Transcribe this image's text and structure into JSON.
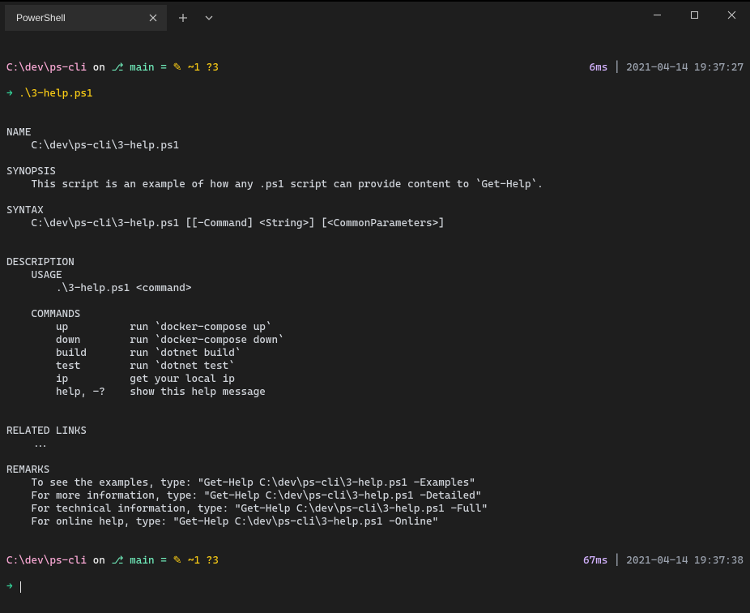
{
  "tab": {
    "label": "PowerShell"
  },
  "prompt1": {
    "path": "C:\\dev\\ps-cli",
    "on": " on ",
    "branch": "main",
    "eq": " =",
    "dirty": "~1 ?3",
    "elapsed": "6ms",
    "pipe": " │ ",
    "timestamp": "2021-04-14 19:37:27",
    "arrow": "→",
    "command": ".\\3-help.ps1"
  },
  "output": "\nNAME\n    C:\\dev\\ps-cli\\3-help.ps1\n\nSYNOPSIS\n    This script is an example of how any .ps1 script can provide content to `Get-Help`.\n\nSYNTAX\n    C:\\dev\\ps-cli\\3-help.ps1 [[-Command] <String>] [<CommonParameters>]\n\n\nDESCRIPTION\n    USAGE\n        .\\3-help.ps1 <command>\n\n    COMMANDS\n        up          run `docker-compose up`\n        down        run `docker-compose down`\n        build       run `dotnet build`\n        test        run `dotnet test`\n        ip          get your local ip\n        help, -?    show this help message\n\n\nRELATED LINKS\n    ...\n\nREMARKS\n    To see the examples, type: \"Get-Help C:\\dev\\ps-cli\\3-help.ps1 -Examples\"\n    For more information, type: \"Get-Help C:\\dev\\ps-cli\\3-help.ps1 -Detailed\"\n    For technical information, type: \"Get-Help C:\\dev\\ps-cli\\3-help.ps1 -Full\"\n    For online help, type: \"Get-Help C:\\dev\\ps-cli\\3-help.ps1 -Online\"\n\n",
  "prompt2": {
    "path": "C:\\dev\\ps-cli",
    "on": " on ",
    "branch": "main",
    "eq": " =",
    "dirty": "~1 ?3",
    "elapsed": "67ms",
    "pipe": " │ ",
    "timestamp": "2021-04-14 19:37:38",
    "arrow": "→"
  }
}
